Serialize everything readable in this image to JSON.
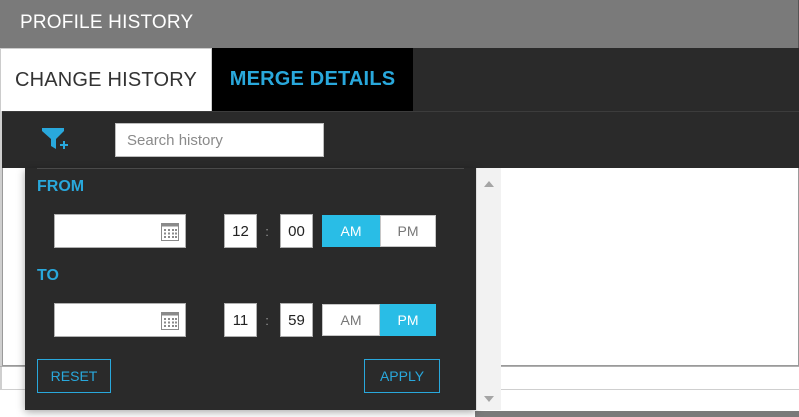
{
  "window": {
    "title": "PROFILE HISTORY"
  },
  "tabs": [
    {
      "label": "CHANGE HISTORY",
      "active": true
    },
    {
      "label": "MERGE DETAILS",
      "active": false
    }
  ],
  "toolbar": {
    "filter_icon": "filter-add-icon",
    "search": {
      "placeholder": "Search history",
      "value": ""
    }
  },
  "filter_popup": {
    "from": {
      "label": "FROM",
      "date_value": "",
      "hour": "12",
      "minute": "00",
      "separator": ":",
      "am_label": "AM",
      "pm_label": "PM",
      "selected_period": "AM"
    },
    "to": {
      "label": "TO",
      "date_value": "",
      "hour": "11",
      "minute": "59",
      "separator": ":",
      "am_label": "AM",
      "pm_label": "PM",
      "selected_period": "PM"
    },
    "reset_label": "RESET",
    "apply_label": "APPLY",
    "calendar_icon": "calendar-icon"
  },
  "colors": {
    "accent": "#29a8dc",
    "active_toggle": "#29bde6",
    "title_bar": "#7a7a7a",
    "panel_dark": "#2a2a2a"
  }
}
